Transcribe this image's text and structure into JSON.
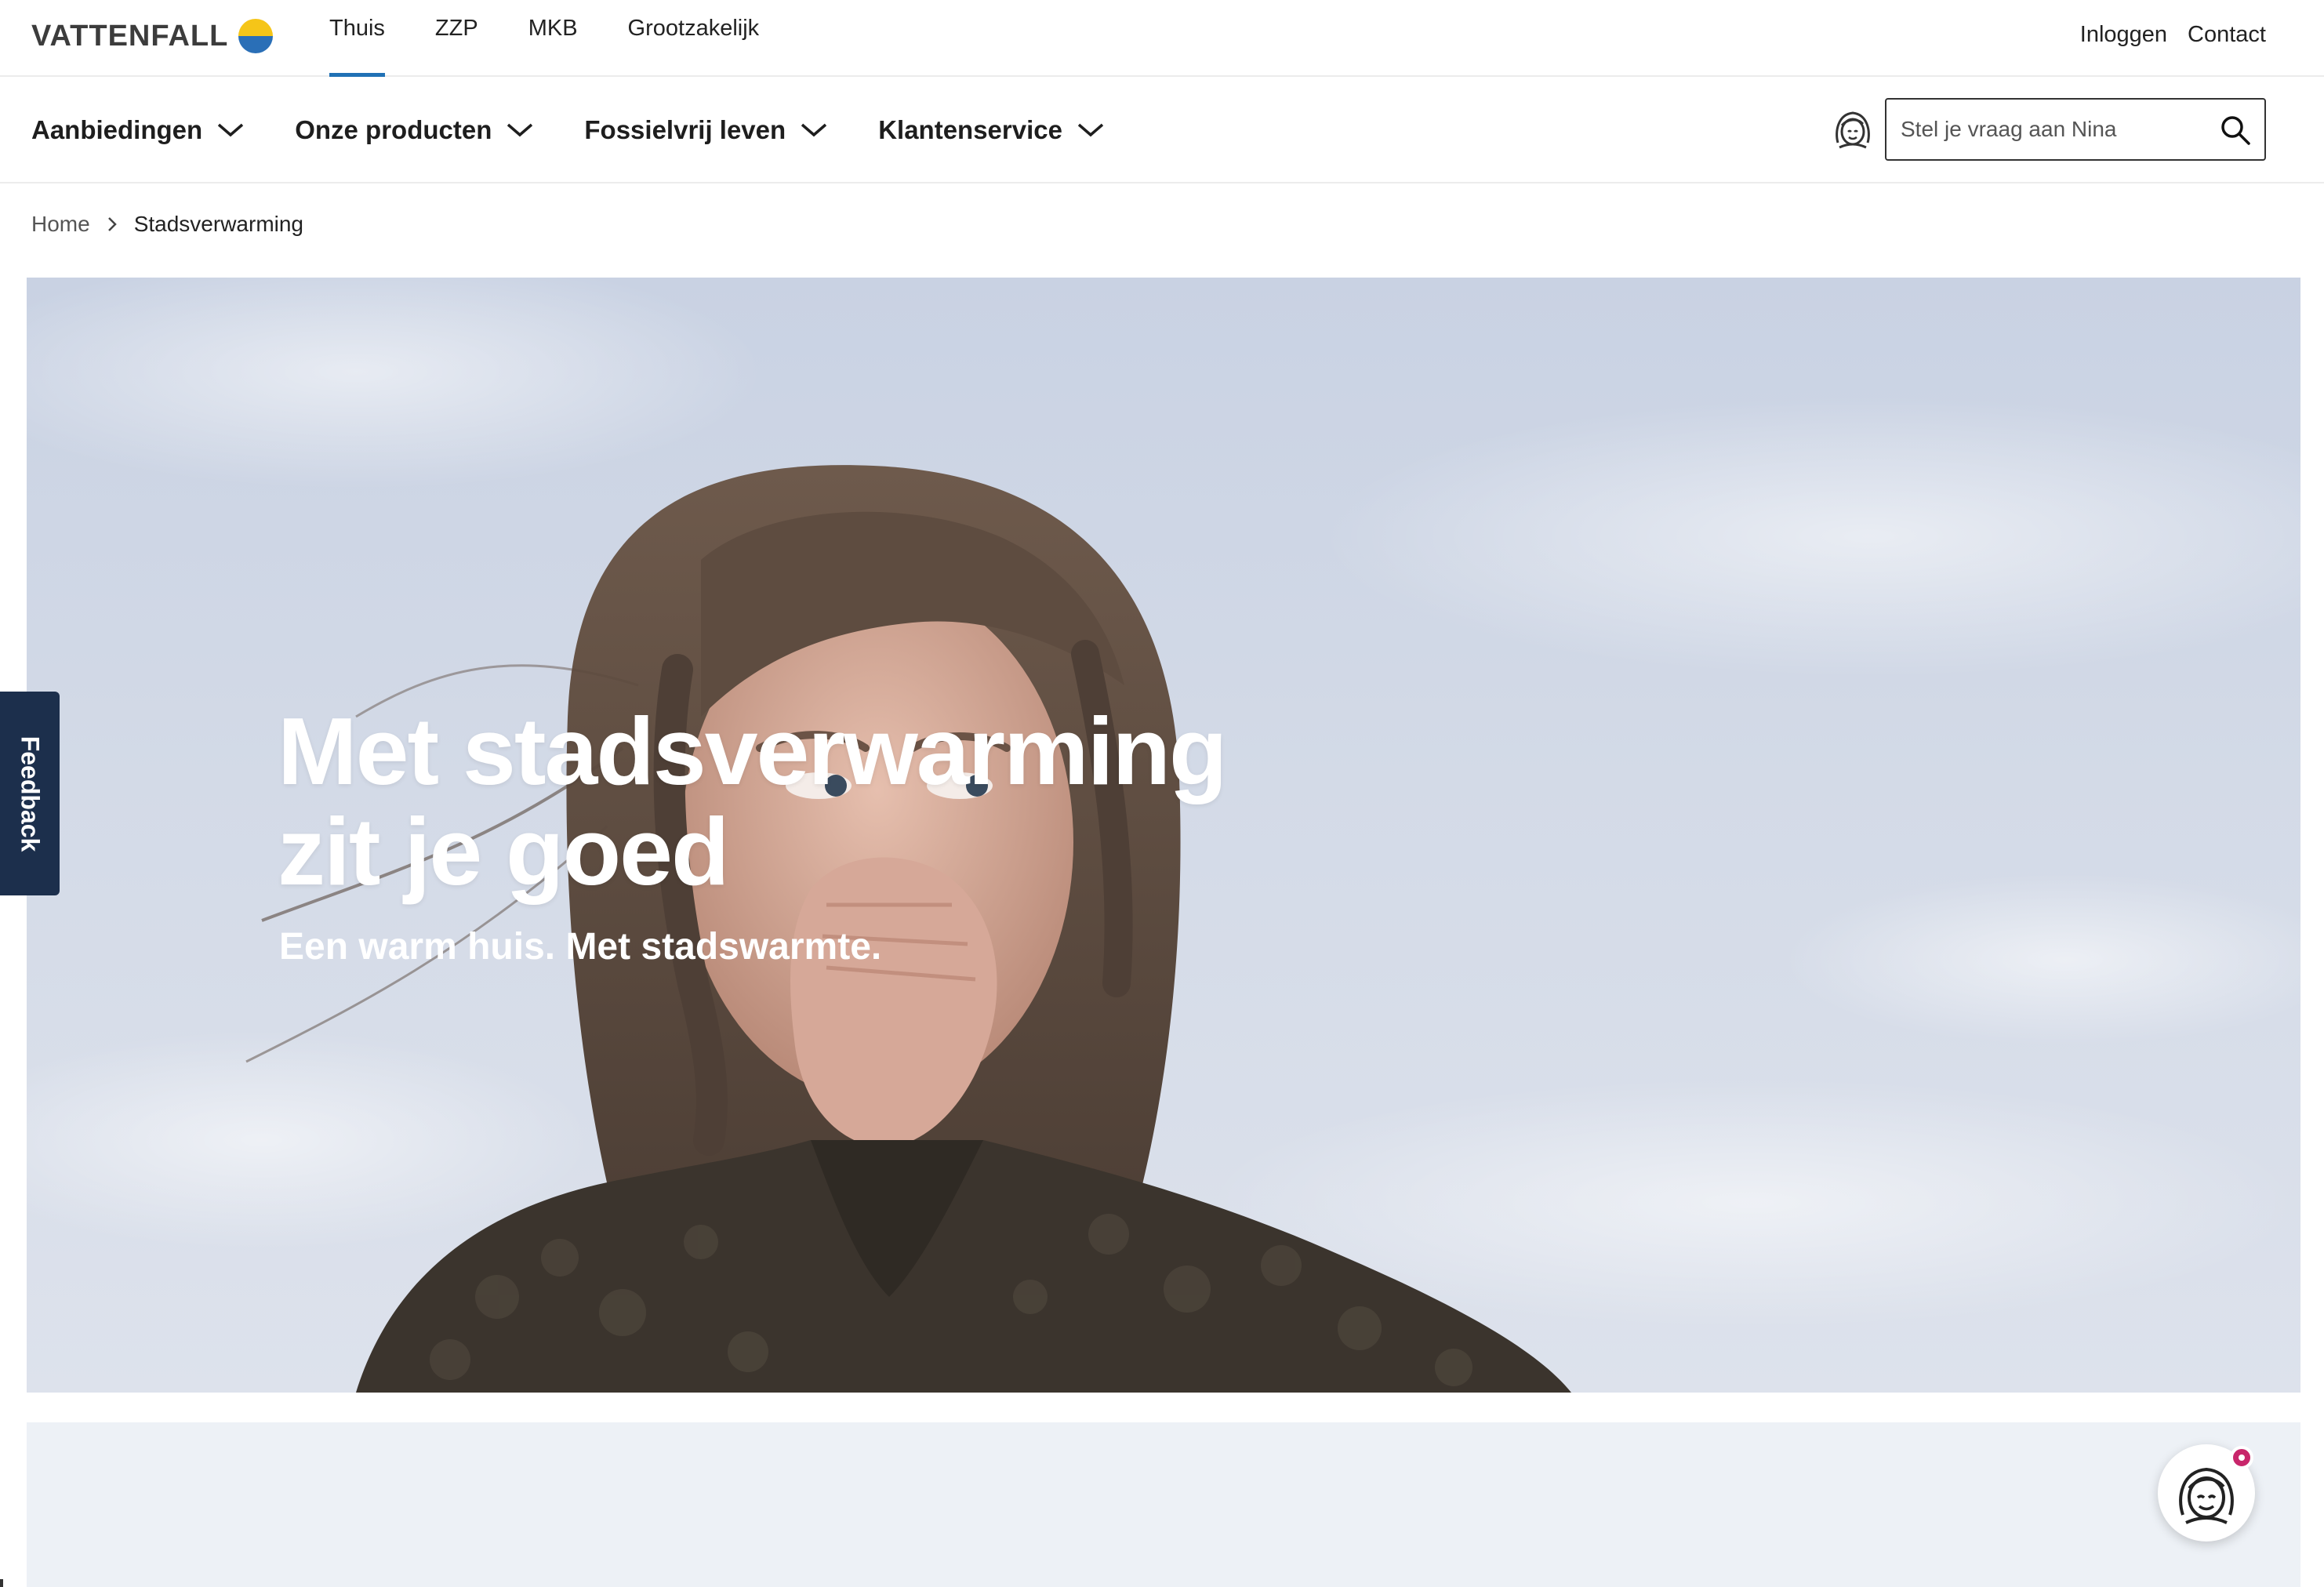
{
  "brand": {
    "name": "VATTENFALL",
    "mark_colors": {
      "top": "#f5c518",
      "bottom": "#2a6fb7"
    }
  },
  "segments": [
    {
      "label": "Thuis",
      "active": true
    },
    {
      "label": "ZZP",
      "active": false
    },
    {
      "label": "MKB",
      "active": false
    },
    {
      "label": "Grootzakelijk",
      "active": false
    }
  ],
  "top_links": {
    "login": "Inloggen",
    "contact": "Contact"
  },
  "main_nav": [
    {
      "label": "Aanbiedingen"
    },
    {
      "label": "Onze producten"
    },
    {
      "label": "Fossielvrij leven"
    },
    {
      "label": "Klantenservice"
    }
  ],
  "search": {
    "placeholder": "Stel je vraag aan Nina",
    "value": ""
  },
  "breadcrumb": {
    "home": "Home",
    "current": "Stadsverwarming"
  },
  "hero": {
    "title_line1": "Met stadsverwarming",
    "title_line2": "zit je goed",
    "subtitle": "Een warm huis. Met stadswarmte."
  },
  "feedback": {
    "label": "Feedback"
  },
  "colors": {
    "accent": "#2071b5",
    "feedback_bg": "#1c2f4c",
    "notification": "#c8266b",
    "lower_panel": "#edf1f6"
  },
  "icons": {
    "chevron": "chevron-down-icon",
    "search": "search-icon",
    "assistant": "assistant-face-icon",
    "breadcrumb_sep": "chevron-right-icon"
  }
}
